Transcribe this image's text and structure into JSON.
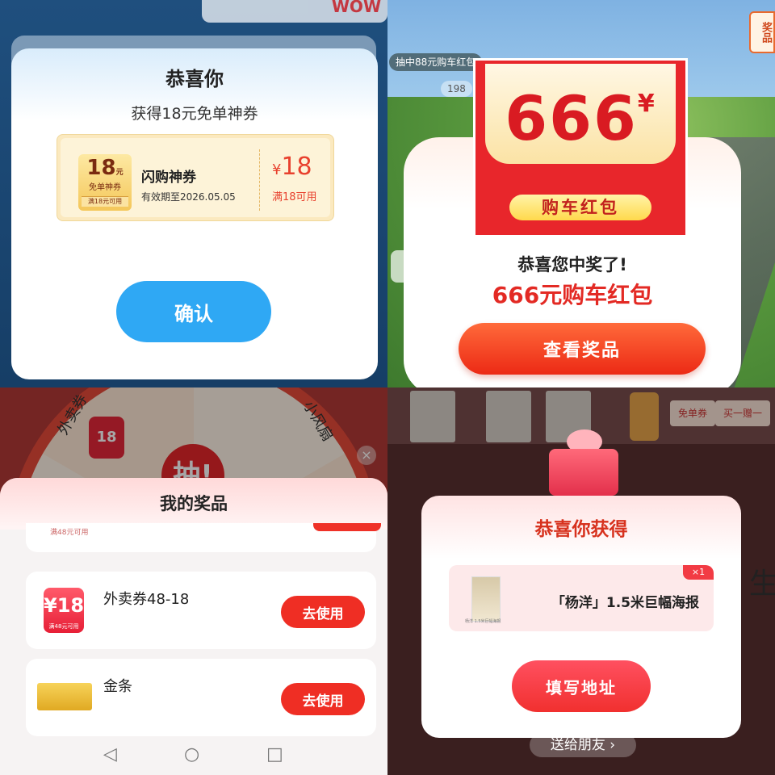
{
  "q1": {
    "top_badge": "WOW",
    "title": "恭喜你",
    "subtitle": "获得18元免单神券",
    "coupon": {
      "ticket_amount": "18",
      "ticket_unit": "元",
      "ticket_type": "免单神券",
      "ticket_condition": "满18元可用",
      "name": "闪购神券",
      "expiry": "有效期至2026.05.05",
      "currency": "¥",
      "amount": "18",
      "condition": "满18可用"
    },
    "confirm_label": "确认",
    "colors": {
      "confirm": "#2fa8f4",
      "amount": "#e8412e"
    }
  },
  "q2": {
    "marquee": "抽中88元购车红包",
    "side_pill": "198",
    "prizes_tab": "奖品",
    "envelope_amount": "666",
    "envelope_currency": "¥",
    "envelope_label": "购车红包",
    "congrats": "恭喜您中奖了!",
    "prize": "666元购车红包",
    "view_button": "查看奖品",
    "colors": {
      "prize": "#e32a24",
      "button": "#ec2a15"
    }
  },
  "q3": {
    "wheel_labels": [
      "外卖券",
      "小风扇"
    ],
    "wheel_red_amount": "18",
    "wheel_center": "抽!",
    "close_icon": "×",
    "sheet_title": "我的奖品",
    "prev_condition": "满48元可用",
    "items": [
      {
        "name": "外卖券48-18",
        "badge_amount": "¥18",
        "badge_condition": "满48元可用",
        "button": "去使用"
      },
      {
        "name": "金条",
        "button": "去使用"
      }
    ],
    "nav": {
      "back": "◁",
      "home": "○",
      "recent": "□"
    }
  },
  "q4": {
    "tags": [
      "免单券",
      "买一赠一"
    ],
    "title": "恭喜你获得",
    "quantity": "×1",
    "poster_caption": "杨洋 1.5米巨幅海报",
    "prize_name": "「杨洋」1.5米巨幅海报",
    "address_button": "填写地址",
    "share": "送给朋友 ›",
    "side_text": "生"
  }
}
